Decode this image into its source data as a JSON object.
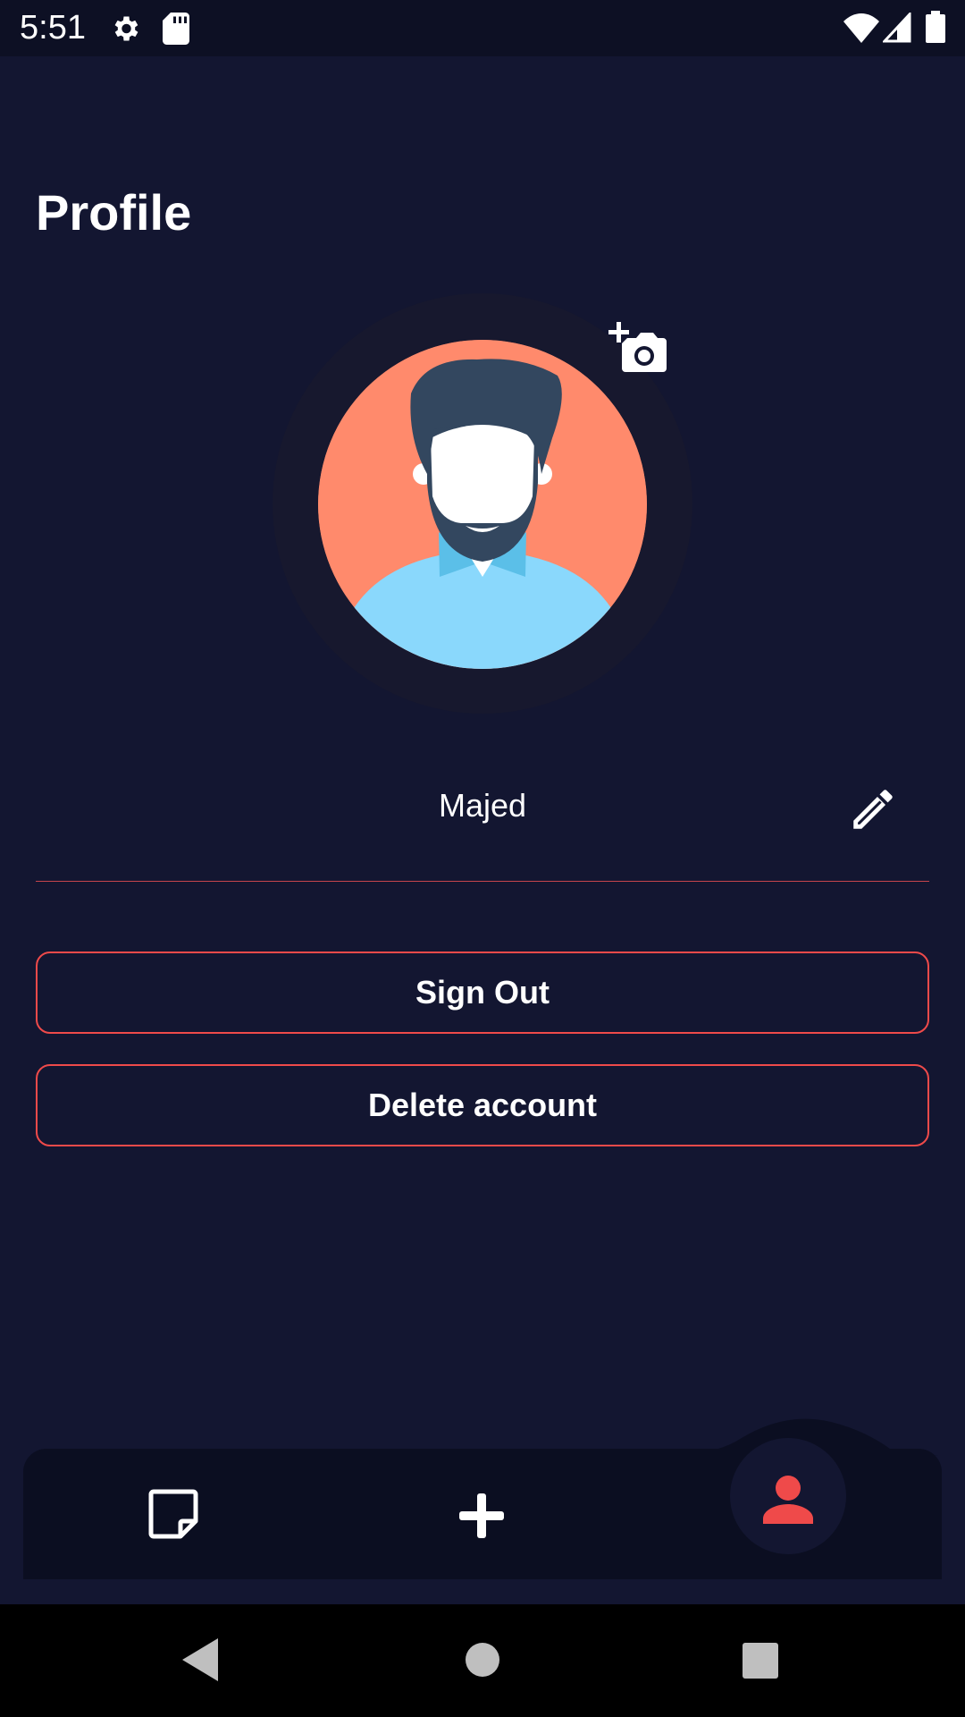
{
  "status_bar": {
    "time": "5:51",
    "icons": [
      "gear-icon",
      "sd-card-icon",
      "wifi-icon",
      "signal-icon",
      "battery-icon"
    ]
  },
  "page": {
    "title": "Profile"
  },
  "profile": {
    "name": "Majed",
    "avatar_icon": "default-avatar",
    "change_photo_icon": "add-a-photo-icon",
    "edit_icon": "pencil-icon"
  },
  "actions": {
    "sign_out": "Sign Out",
    "delete_account": "Delete account"
  },
  "bottom_nav": {
    "items": [
      {
        "icon": "note-icon",
        "active": false
      },
      {
        "icon": "plus-icon",
        "active": false
      },
      {
        "icon": "person-icon",
        "active": true
      }
    ]
  },
  "system_nav": [
    "back-icon",
    "home-icon",
    "recents-icon"
  ],
  "colors": {
    "background": "#131631",
    "accent": "#ef4a4a",
    "nav_background": "#0b0e21"
  }
}
